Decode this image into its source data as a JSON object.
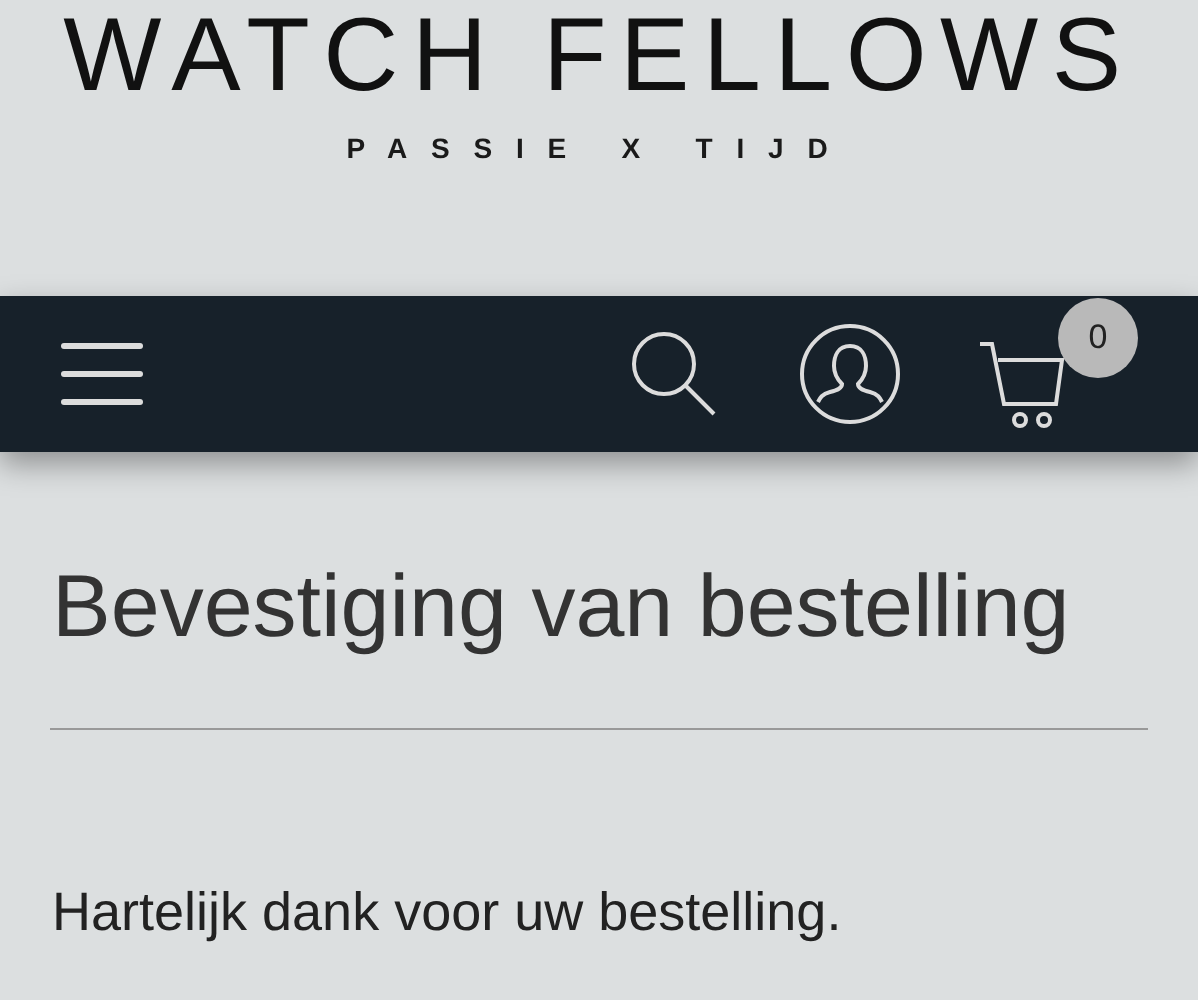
{
  "logo": {
    "title": "WATCH FELLOWS",
    "tagline": "PASSIE X TIJD"
  },
  "navbar": {
    "cart_count": "0"
  },
  "heading": "Bevestiging van bestelling",
  "message": "Hartelijk dank voor uw bestelling."
}
